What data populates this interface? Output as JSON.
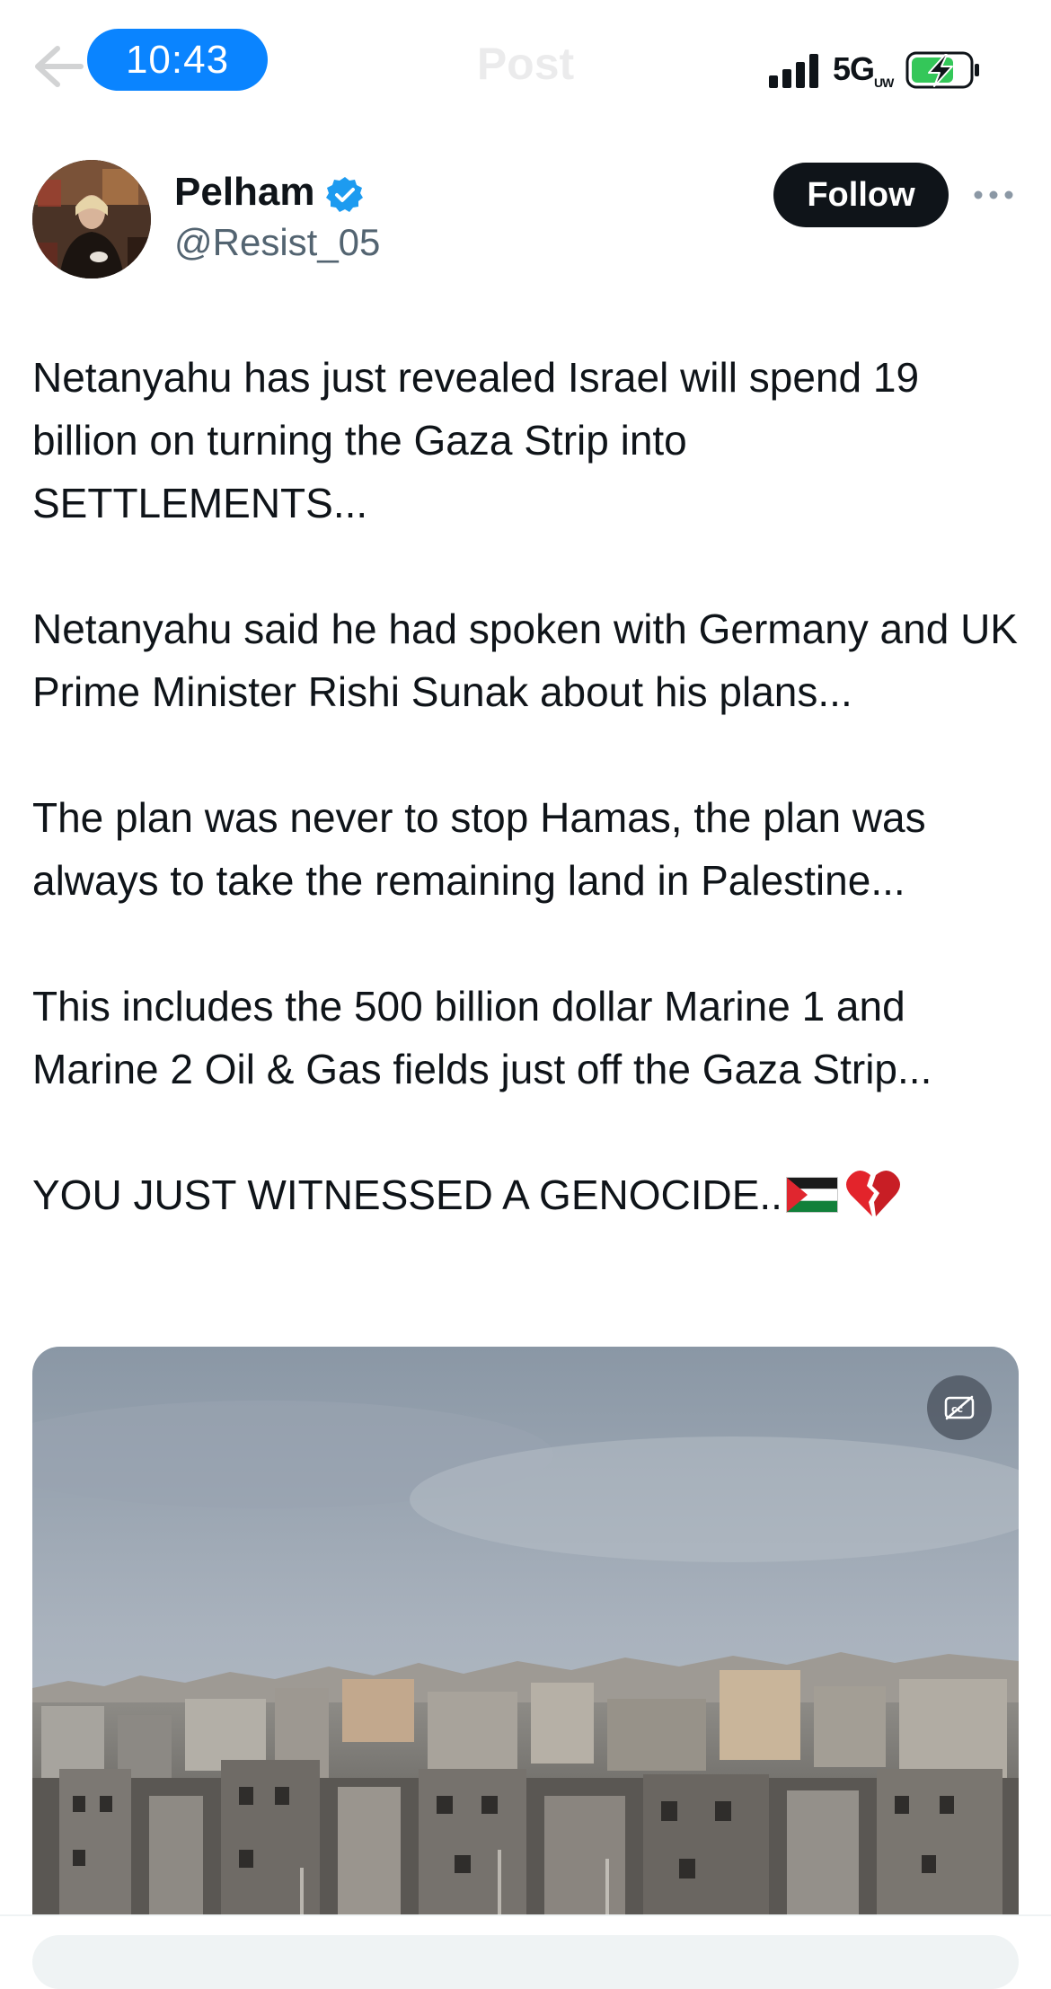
{
  "status_bar": {
    "time": "10:43",
    "network": "5G",
    "network_sub": "UW"
  },
  "nav": {
    "title": "Post"
  },
  "author": {
    "name": "Pelham",
    "handle": "@Resist_05",
    "verified": true
  },
  "actions": {
    "follow_label": "Follow"
  },
  "tweet": {
    "paragraphs": [
      "Netanyahu has just revealed Israel will spend 19 billion on turning the Gaza Strip into SETTLEMENTS...",
      "Netanyahu said he had spoken with Germany and UK Prime Minister Rishi Sunak about his plans...",
      "The plan was never to stop Hamas, the plan was always to take the remaining land in Palestine...",
      "This includes the 500 billion dollar Marine 1 and Marine 2 Oil & Gas fields just off the Gaza Strip..."
    ],
    "closing_line": "YOU JUST WITNESSED A GENOCIDE..",
    "closing_emojis": [
      "palestine-flag-icon",
      "broken-heart-icon"
    ]
  },
  "colors": {
    "accent": "#0a84ff",
    "verified": "#1d9bf0",
    "follow_bg": "#0f1419",
    "handle": "#536471",
    "battery_fill": "#34c759"
  }
}
